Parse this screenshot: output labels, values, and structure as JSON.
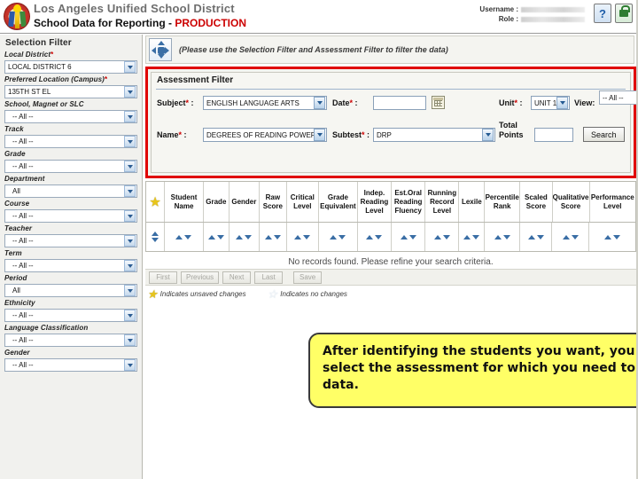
{
  "header": {
    "district_name": "Los Angeles Unified School District",
    "app_title": "School Data for Reporting -",
    "environment": "PRODUCTION",
    "username_label": "Username :",
    "role_label": "Role :",
    "help_icon": "?",
    "logo": "lausd-seal-logo",
    "accent_red": "#cc0000",
    "district_gray": "#6e6e6e"
  },
  "sidebar": {
    "title": "Selection Filter",
    "items": [
      {
        "label": "Local District",
        "required": true,
        "value": "LOCAL DISTRICT 6"
      },
      {
        "label": "Preferred Location (Campus)",
        "required": true,
        "value": "135TH ST EL"
      },
      {
        "label": "School, Magnet or SLC",
        "required": false,
        "value": "-- All --"
      },
      {
        "label": "Track",
        "required": false,
        "value": "-- All --"
      },
      {
        "label": "Grade",
        "required": false,
        "value": "-- All --"
      },
      {
        "label": "Department",
        "required": false,
        "value": "All"
      },
      {
        "label": "Course",
        "required": false,
        "value": "-- All --"
      },
      {
        "label": "Teacher",
        "required": false,
        "value": "-- All --"
      },
      {
        "label": "Term",
        "required": false,
        "value": "-- All --"
      },
      {
        "label": "Period",
        "required": false,
        "value": "All"
      },
      {
        "label": "Ethnicity",
        "required": false,
        "value": "-- All --"
      },
      {
        "label": "Language Classification",
        "required": false,
        "value": "-- All --"
      },
      {
        "label": "Gender",
        "required": false,
        "value": "-- All --"
      }
    ]
  },
  "main": {
    "hint_text": "(Please use the Selection Filter and Assessment Filter to filter the data)",
    "nav_icon": "four-way-arrow-icon"
  },
  "assessment_filter": {
    "title": "Assessment Filter",
    "subject_label": "Subject",
    "subject_value": "ENGLISH LANGUAGE ARTS",
    "date_label": "Date",
    "date_value": "",
    "calendar_icon": "calendar-icon",
    "unit_label": "Unit",
    "unit_value": "UNIT 1",
    "view_label": "View:",
    "view_value": "-- All --",
    "name_label": "Name",
    "name_value": "DEGREES OF READING POWER",
    "subtest_label": "Subtest",
    "subtest_value": "DRP",
    "total_points_label_1": "Total",
    "total_points_label_2": "Points",
    "total_points_value": "",
    "search_label": "Search",
    "required_marker": "*",
    "highlight_color": "#e00000"
  },
  "results": {
    "star_icon": "star-icon",
    "columns": [
      "Student Name",
      "Grade",
      "Gender",
      "Raw Score",
      "Critical Level",
      "Grade Equivalent",
      "Indep. Reading Level",
      "Est.Oral Reading Fluency",
      "Running Record Level",
      "Lexile",
      "Percentile Rank",
      "Scaled Score",
      "Qualitative Score",
      "Performance Level"
    ],
    "empty_message": "No records found. Please refine your search criteria.",
    "pager_buttons": [
      "First",
      "Previous",
      "Next",
      "Last",
      "Save"
    ],
    "legend_unsaved": "Indicates unsaved changes",
    "legend_nochanges": "Indicates no changes"
  },
  "callout": {
    "text": "After identifying the students you want, you need to select the assessment for which you need to enter data.",
    "background": "#ffff66"
  }
}
